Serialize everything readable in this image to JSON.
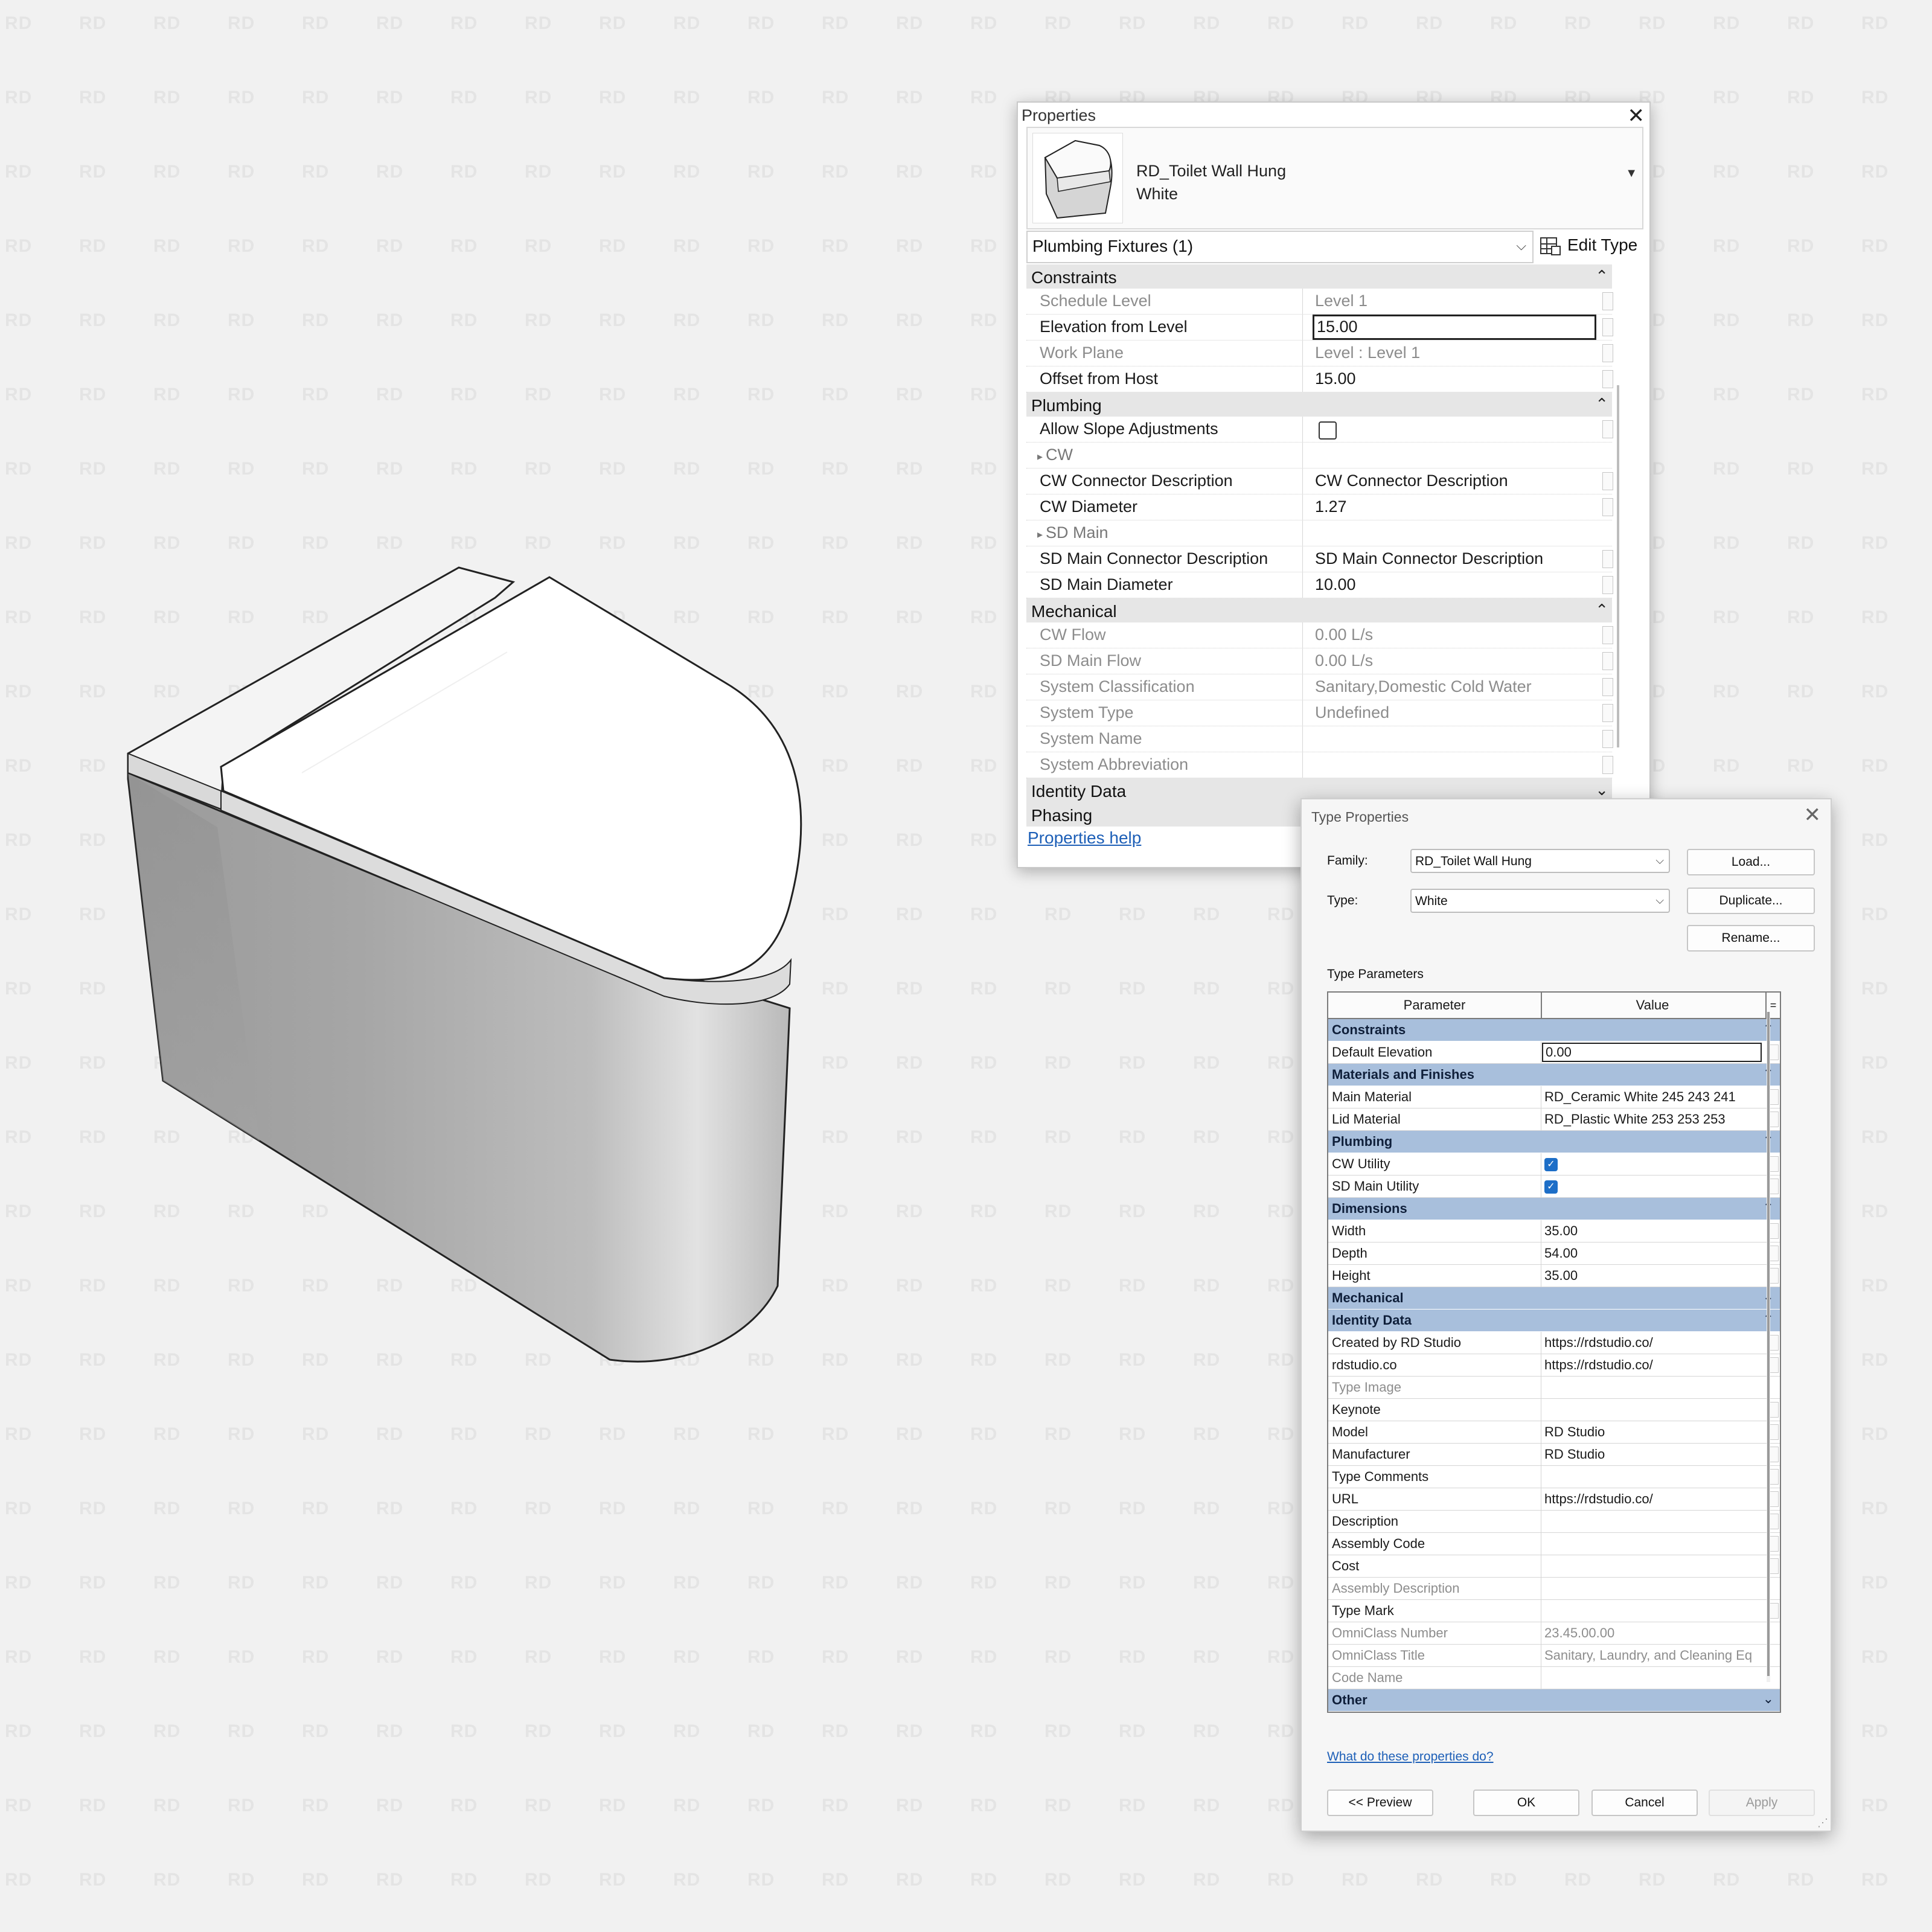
{
  "watermark": "RD",
  "properties": {
    "title": "Properties",
    "close_icon": "close-icon",
    "type_selector": {
      "family": "RD_Toilet Wall Hung",
      "type": "White"
    },
    "instance_filter": "Plumbing Fixtures (1)",
    "edit_type": "Edit Type",
    "help_link": "Properties help",
    "groups": [
      {
        "title": "Constraints",
        "collapsed": false,
        "rows": [
          {
            "name": "Schedule Level",
            "value": "Level 1",
            "readonly": true
          },
          {
            "name": "Elevation from Level",
            "value": "15.00",
            "editing": true
          },
          {
            "name": "Work Plane",
            "value": "Level : Level 1",
            "readonly": true
          },
          {
            "name": "Offset from Host",
            "value": "15.00"
          }
        ]
      },
      {
        "title": "Plumbing",
        "collapsed": false,
        "rows": [
          {
            "name": "Allow Slope Adjustments",
            "checkbox": true,
            "checked": false
          },
          {
            "name": "CW",
            "sub": true,
            "value": ""
          },
          {
            "name": "CW Connector Description",
            "value": "CW Connector Description"
          },
          {
            "name": "CW Diameter",
            "value": "1.27"
          },
          {
            "name": "SD Main",
            "sub": true,
            "value": ""
          },
          {
            "name": "SD Main Connector Description",
            "value": "SD Main Connector Description"
          },
          {
            "name": "SD Main Diameter",
            "value": "10.00"
          }
        ]
      },
      {
        "title": "Mechanical",
        "collapsed": false,
        "rows": [
          {
            "name": "CW Flow",
            "value": "0.00 L/s",
            "readonly": true
          },
          {
            "name": "SD Main Flow",
            "value": "0.00 L/s",
            "readonly": true
          },
          {
            "name": "System Classification",
            "value": "Sanitary,Domestic Cold Water",
            "readonly": true
          },
          {
            "name": "System Type",
            "value": "Undefined",
            "readonly": true
          },
          {
            "name": "System Name",
            "value": "",
            "readonly": true
          },
          {
            "name": "System Abbreviation",
            "value": "",
            "readonly": true
          }
        ]
      },
      {
        "title": "Identity Data",
        "collapsed": true,
        "rows": []
      },
      {
        "title": "Phasing",
        "collapsed": true,
        "rows": []
      }
    ]
  },
  "type_properties": {
    "title": "Type Properties",
    "family_label": "Family:",
    "family_value": "RD_Toilet Wall Hung",
    "type_label": "Type:",
    "type_value": "White",
    "load_button": "Load...",
    "duplicate_button": "Duplicate...",
    "rename_button": "Rename...",
    "section_label": "Type Parameters",
    "col_parameter": "Parameter",
    "col_value": "Value",
    "col_eq": "=",
    "groups": [
      {
        "title": "Constraints",
        "collapsed": false,
        "rows": [
          {
            "name": "Default Elevation",
            "value": "0.00",
            "editing": true
          }
        ]
      },
      {
        "title": "Materials and Finishes",
        "collapsed": false,
        "rows": [
          {
            "name": "Main Material",
            "value": "RD_Ceramic White 245 243 241"
          },
          {
            "name": "Lid Material",
            "value": "RD_Plastic White 253 253 253"
          }
        ]
      },
      {
        "title": "Plumbing",
        "collapsed": false,
        "rows": [
          {
            "name": "CW Utility",
            "checkbox": true,
            "checked": true
          },
          {
            "name": "SD Main Utility",
            "checkbox": true,
            "checked": true
          }
        ]
      },
      {
        "title": "Dimensions",
        "collapsed": false,
        "rows": [
          {
            "name": "Width",
            "value": "35.00"
          },
          {
            "name": "Depth",
            "value": "54.00"
          },
          {
            "name": "Height",
            "value": "35.00"
          }
        ]
      },
      {
        "title": "Mechanical",
        "collapsed": true,
        "rows": []
      },
      {
        "title": "Identity Data",
        "collapsed": false,
        "rows": [
          {
            "name": "Created by RD Studio",
            "value": "https://rdstudio.co/"
          },
          {
            "name": "rdstudio.co",
            "value": "https://rdstudio.co/"
          },
          {
            "name": "Type Image",
            "value": "",
            "readonly": true
          },
          {
            "name": "Keynote",
            "value": ""
          },
          {
            "name": "Model",
            "value": "RD Studio"
          },
          {
            "name": "Manufacturer",
            "value": "RD Studio"
          },
          {
            "name": "Type Comments",
            "value": ""
          },
          {
            "name": "URL",
            "value": "https://rdstudio.co/"
          },
          {
            "name": "Description",
            "value": ""
          },
          {
            "name": "Assembly Code",
            "value": ""
          },
          {
            "name": "Cost",
            "value": ""
          },
          {
            "name": "Assembly Description",
            "value": "",
            "readonly": true
          },
          {
            "name": "Type Mark",
            "value": ""
          },
          {
            "name": "OmniClass Number",
            "value": "23.45.00.00",
            "readonly": true
          },
          {
            "name": "OmniClass Title",
            "value": "Sanitary, Laundry, and Cleaning Eq",
            "readonly": true
          },
          {
            "name": "Code Name",
            "value": "",
            "readonly": true
          }
        ]
      },
      {
        "title": "Other",
        "collapsed": true,
        "rows": []
      }
    ],
    "help_link": "What do these properties do?",
    "preview_button": "<< Preview",
    "ok_button": "OK",
    "cancel_button": "Cancel",
    "apply_button": "Apply"
  }
}
